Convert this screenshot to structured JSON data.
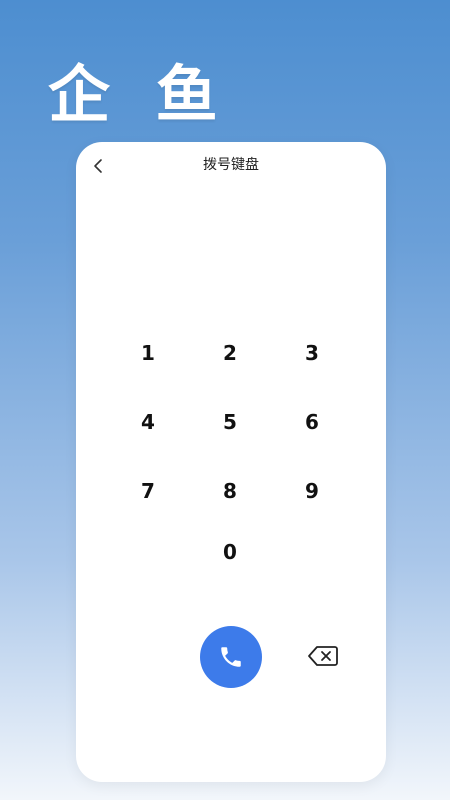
{
  "brand": {
    "title": "企 鱼"
  },
  "dialer": {
    "title": "拨号键盘",
    "keys": [
      "1",
      "2",
      "3",
      "4",
      "5",
      "6",
      "7",
      "8",
      "9",
      "0"
    ]
  },
  "icons": {
    "back": "chevron-left-icon",
    "call": "phone-icon",
    "delete": "backspace-icon"
  },
  "colors": {
    "call_button": "#3d7bea",
    "background_top": "#4d8ed0",
    "background_bottom": "#f2f6fb"
  }
}
